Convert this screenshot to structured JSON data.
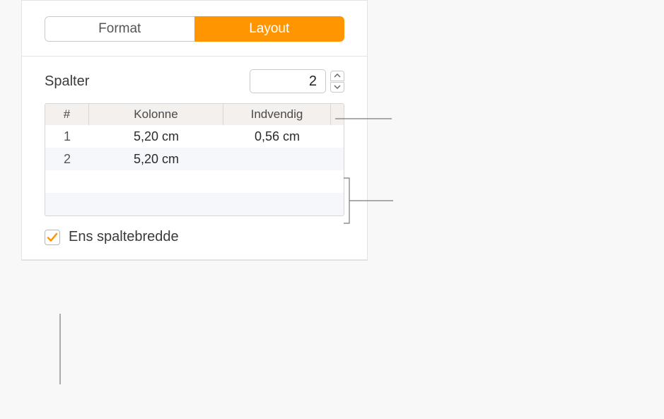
{
  "tabs": {
    "format": "Format",
    "layout": "Layout"
  },
  "columns": {
    "label": "Spalter",
    "count": "2",
    "headers": {
      "num": "#",
      "kolonne": "Kolonne",
      "indvendig": "Indvendig"
    },
    "rows": [
      {
        "n": "1",
        "kolonne": "5,20 cm",
        "indvendig": "0,56 cm"
      },
      {
        "n": "2",
        "kolonne": "5,20 cm",
        "indvendig": ""
      }
    ]
  },
  "equal_width": {
    "label": "Ens spaltebredde",
    "checked": true
  }
}
